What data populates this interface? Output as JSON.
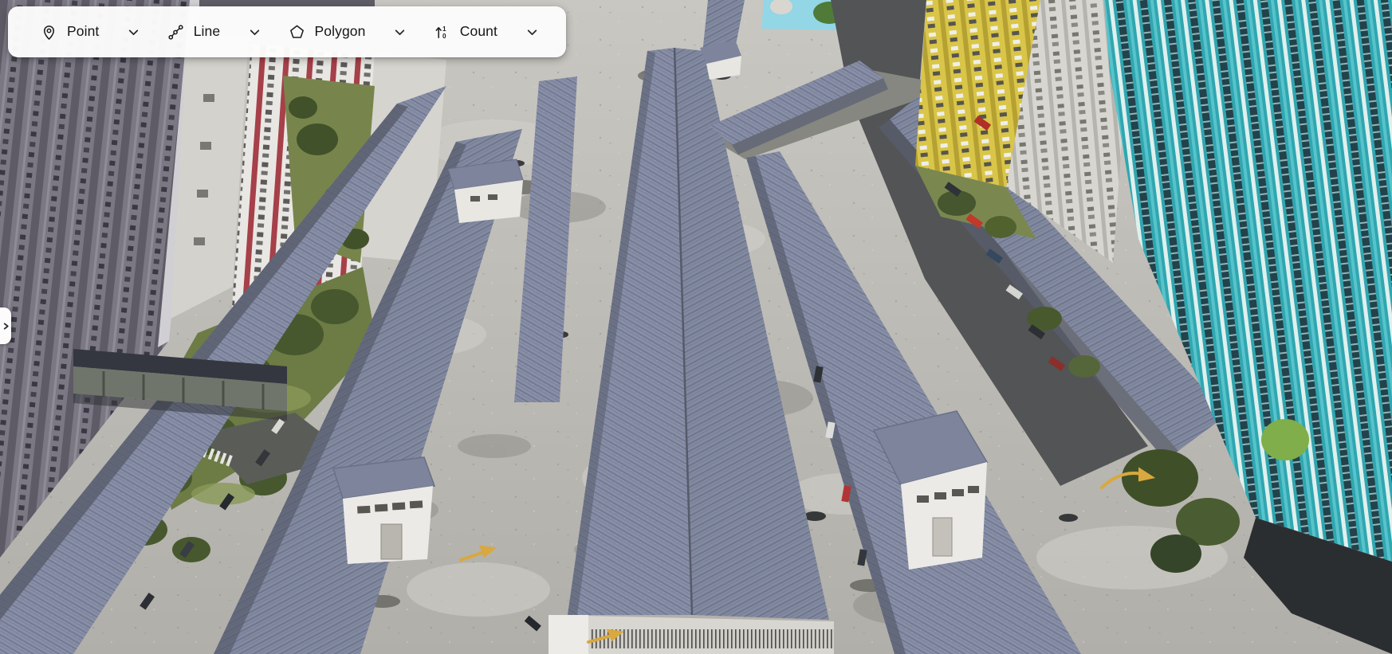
{
  "toolbar": {
    "items": [
      {
        "label": "Point",
        "icon": "map-pin"
      },
      {
        "label": "Line",
        "icon": "polyline-nodes"
      },
      {
        "label": "Polygon",
        "icon": "pentagon"
      },
      {
        "label": "Count",
        "icon": "numeric-sort"
      }
    ]
  },
  "side_panel": {
    "collapsed": true,
    "handle_icon": "chevron-right"
  },
  "viewport": {
    "description": "3D aerial photogrammetry view of an apartment complex: rows of covered parking rooftops on a concrete deck between high-rise towers",
    "colors": {
      "roof": "#868da4",
      "concrete": "#bbb9b3",
      "left_tower": "#75727e",
      "teal_tower": "#30a6b0",
      "yellow_tower": "#d9c548",
      "vegetation": "#546539",
      "pool": "#93d6e6"
    }
  }
}
